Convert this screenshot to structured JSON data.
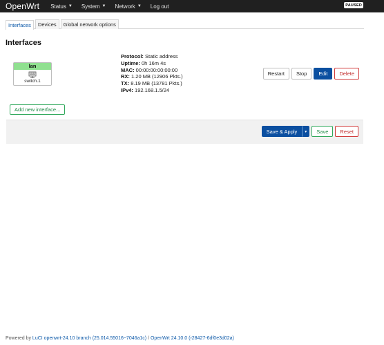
{
  "header": {
    "brand": "OpenWrt",
    "menu": [
      {
        "label": "Status",
        "has_caret": true
      },
      {
        "label": "System",
        "has_caret": true
      },
      {
        "label": "Network",
        "has_caret": true
      },
      {
        "label": "Log out",
        "has_caret": false
      }
    ],
    "badge": "PAUSED"
  },
  "tabs": [
    {
      "label": "Interfaces",
      "active": true
    },
    {
      "label": "Devices",
      "active": false
    },
    {
      "label": "Global network options",
      "active": false
    }
  ],
  "section_title": "Interfaces",
  "interface": {
    "name": "lan",
    "name_color": "#90e090",
    "device": "switch.1",
    "device_icon": "ethernet-switch-icon",
    "status": {
      "protocol_label": "Protocol:",
      "protocol": "Static address",
      "uptime_label": "Uptime:",
      "uptime": "0h 16m 4s",
      "mac_label": "MAC:",
      "mac": "00:00:00:00:00:00",
      "rx_label": "RX:",
      "rx": "1.20 MB (12906 Pkts.)",
      "tx_label": "TX:",
      "tx": "8.19 MB (13781 Pkts.)",
      "ipv4_label": "IPv4:",
      "ipv4": "192.168.1.5/24"
    },
    "actions": {
      "restart": "Restart",
      "stop": "Stop",
      "edit": "Edit",
      "delete": "Delete"
    }
  },
  "add_interface_label": "Add new interface...",
  "action_bar": {
    "save_apply": "Save & Apply",
    "dropdown_glyph": "▾",
    "save": "Save",
    "reset": "Reset"
  },
  "footer": {
    "prefix": "Powered by ",
    "luci_link": "LuCI openwrt-24.10 branch (25.014.55016~7046a1c)",
    "separator": " / ",
    "openwrt_link": "OpenWrt 24.10.0 (r28427-6df0e3d02a)"
  },
  "colors": {
    "topbar": "#202020",
    "primary": "#0b4fa0",
    "positive": "#2fa85a",
    "negative": "#d13a3a",
    "link": "#0b58a8"
  }
}
